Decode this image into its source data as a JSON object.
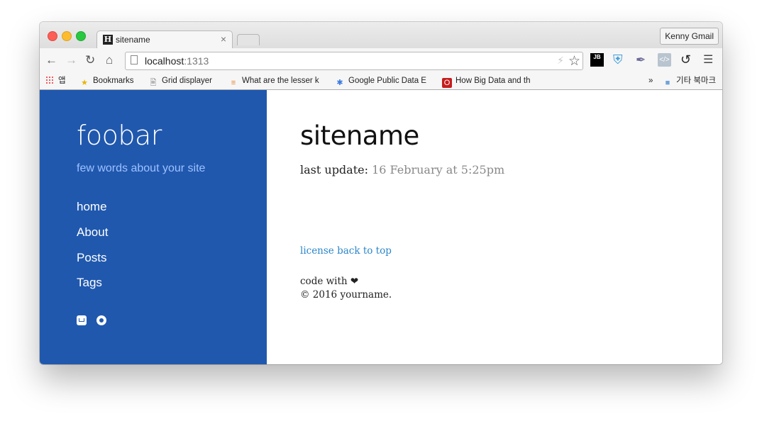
{
  "browser": {
    "tab_title": "sitename",
    "tab_favicon": "H",
    "tab_close": "×",
    "profile_name": "Kenny Gmail",
    "url_host": "localhost",
    "url_port": ":1313",
    "ext_jb": "JB",
    "ext_code": "</>",
    "bookmarks": [
      {
        "label": "앱",
        "icon": "apps-grid-icon"
      },
      {
        "label": "Bookmarks",
        "icon": "star-icon"
      },
      {
        "label": "Grid displayer",
        "icon": "page-icon"
      },
      {
        "label": "What are the lesser k",
        "icon": "stackoverflow-icon"
      },
      {
        "label": "Google Public Data E",
        "icon": "google-icon"
      },
      {
        "label": "How Big Data and th",
        "icon": "opera-icon"
      }
    ],
    "bookmarks_more": "»",
    "other_bookmarks": "기타 북마크"
  },
  "site": {
    "brand": "foobar",
    "tagline": "few words about your site",
    "nav": [
      "home",
      "About",
      "Posts",
      "Tags"
    ],
    "title": "sitename",
    "update_label": "last update:",
    "update_date": "16 February at 5:25pm",
    "footer_license": "license",
    "footer_top": "back to top",
    "code_with": "code with",
    "copyright": "© 2016 yourname."
  }
}
